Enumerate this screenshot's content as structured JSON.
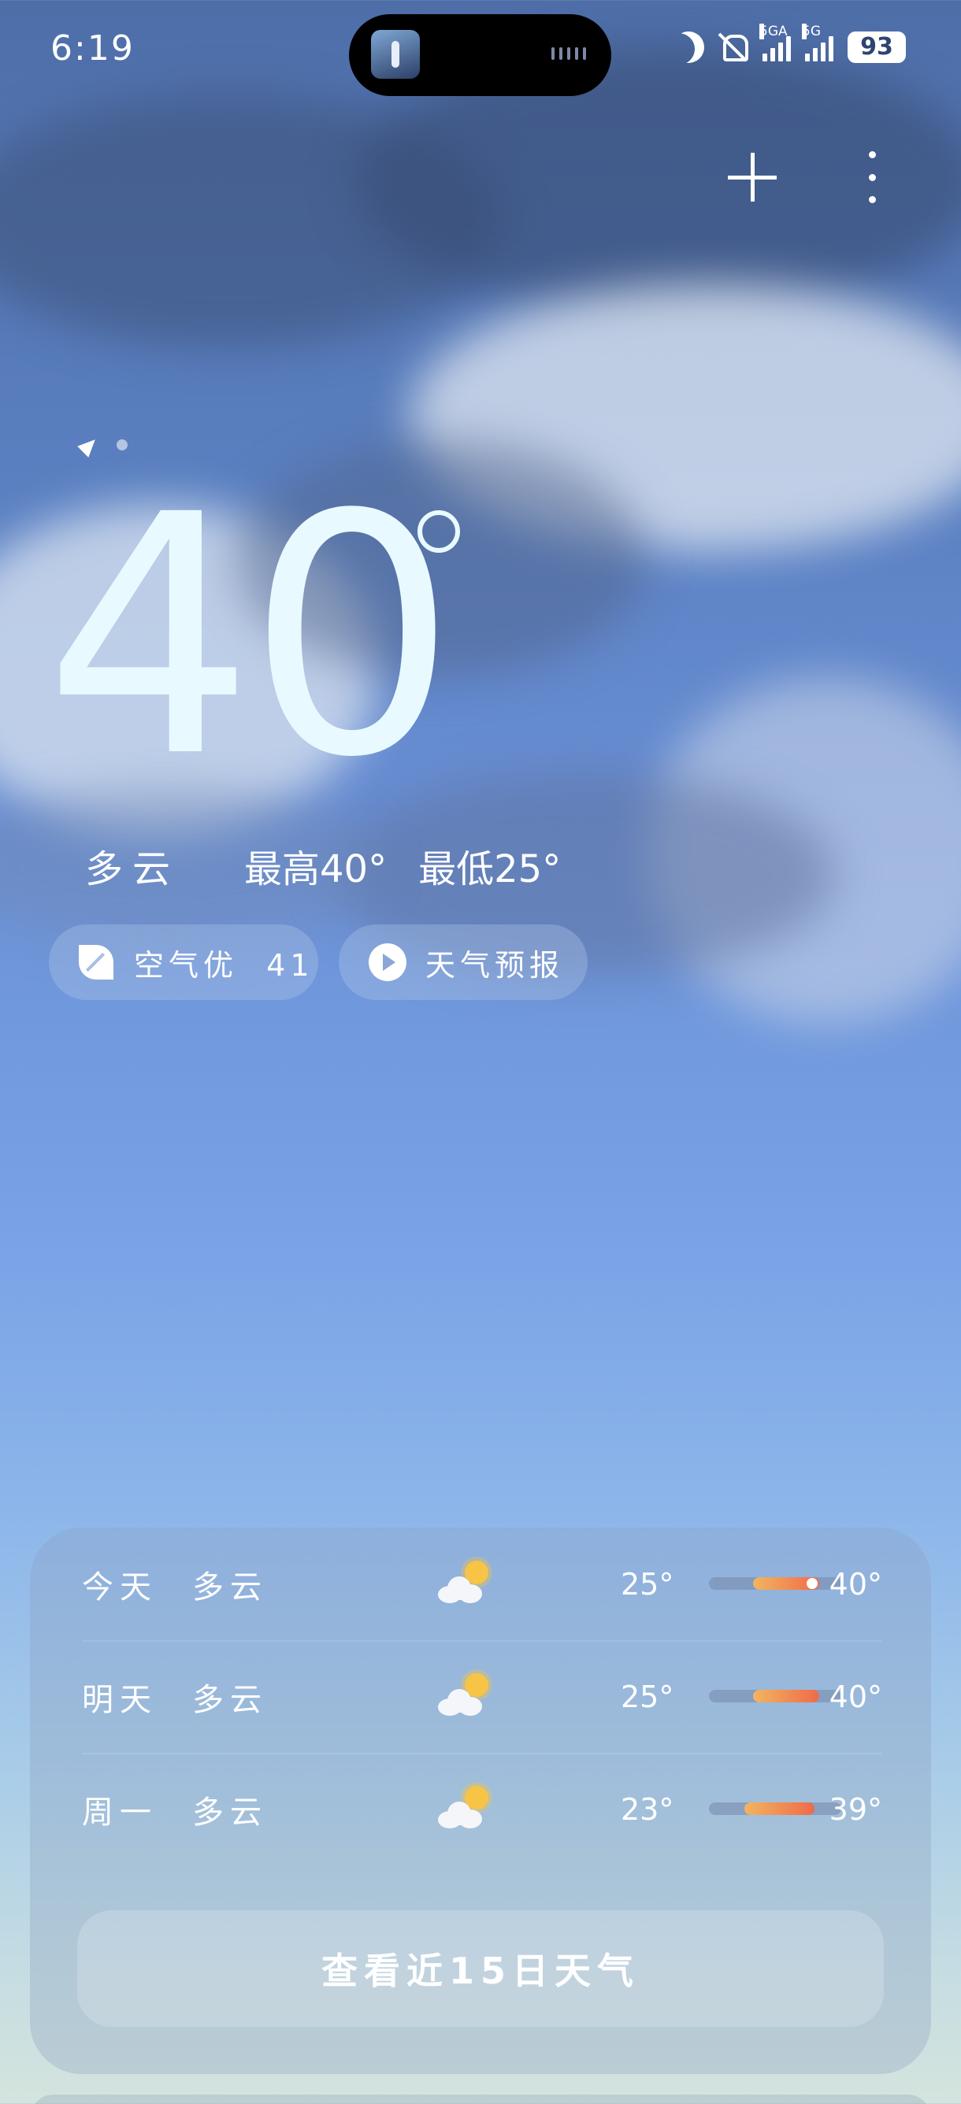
{
  "status_bar": {
    "time": "6:19",
    "network_1": "5GA",
    "network_2": "5G",
    "battery": "93"
  },
  "current": {
    "temperature": "40",
    "condition": "多云",
    "high": "最高40°",
    "low": "最低25°"
  },
  "chips": {
    "air_quality": "空气优  41",
    "forecast": "天气预报"
  },
  "daily": [
    {
      "day": "今天",
      "condition": "多云",
      "icon": "partly-cloudy-icon",
      "low": "25°",
      "high": "40°",
      "low_value": 25,
      "high_value": 40
    },
    {
      "day": "明天",
      "condition": "多云",
      "icon": "partly-cloudy-icon",
      "low": "25°",
      "high": "40°",
      "low_value": 25,
      "high_value": 40
    },
    {
      "day": "周一",
      "condition": "多云",
      "icon": "partly-cloudy-icon",
      "low": "23°",
      "high": "39°",
      "low_value": 23,
      "high_value": 39
    }
  ],
  "more_button": "查看近15日天气",
  "colors": {
    "bar_start": "#f2b560",
    "bar_end": "#ef6a4a",
    "sun": "#f7c445"
  }
}
